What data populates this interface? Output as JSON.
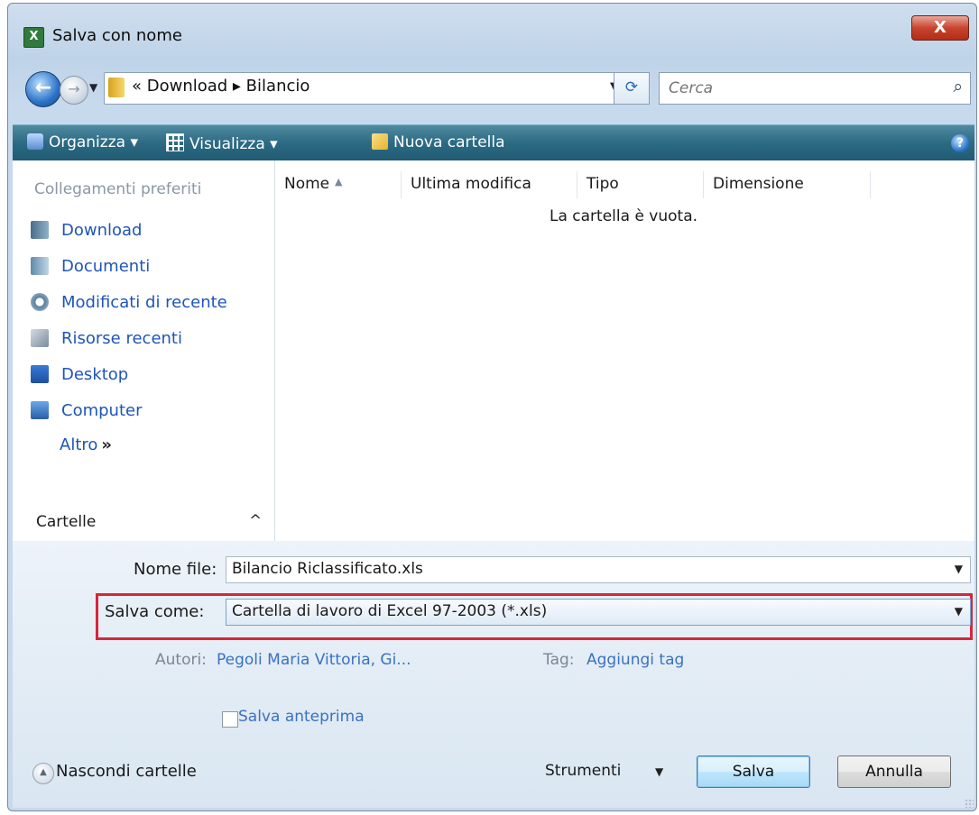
{
  "window": {
    "title": "Salva con nome",
    "close_symbol": "X"
  },
  "nav": {
    "back_symbol": "←",
    "forward_symbol": "→",
    "address": "« Download ▸ Bilancio",
    "search_placeholder": "Cerca"
  },
  "toolbar": {
    "organize": "Organizza ▾",
    "views": "Visualizza ▾",
    "new_folder": "Nuova cartella",
    "help": "?"
  },
  "sidebar": {
    "header": "Collegamenti preferiti",
    "items": [
      {
        "label": "Download",
        "icon": "download-folder-icon"
      },
      {
        "label": "Documenti",
        "icon": "documents-icon"
      },
      {
        "label": "Modificati di recente",
        "icon": "recent-changes-icon"
      },
      {
        "label": "Risorse recenti",
        "icon": "recent-places-icon"
      },
      {
        "label": "Desktop",
        "icon": "desktop-icon"
      },
      {
        "label": "Computer",
        "icon": "computer-icon"
      }
    ],
    "more": "Altro",
    "more_chevrons": "»",
    "folders": "Cartelle",
    "folders_toggle": "^"
  },
  "file_list": {
    "columns": [
      "Nome",
      "Ultima modifica",
      "Tipo",
      "Dimensione"
    ],
    "empty_message": "La cartella è vuota."
  },
  "form": {
    "filename_label": "Nome file:",
    "filename_value": "Bilancio Riclassificato.xls",
    "savetype_label": "Salva come:",
    "savetype_value": "Cartella di lavoro di Excel 97-2003 (*.xls)",
    "authors_label": "Autori:",
    "authors_value": "Pegoli Maria Vittoria, Gi...",
    "tags_label": "Tag:",
    "tags_value": "Aggiungi tag",
    "preview_label": "Salva anteprima"
  },
  "footer": {
    "hide_folders": "Nascondi cartelle",
    "tools": "Strumenti",
    "save": "Salva",
    "cancel": "Annulla"
  },
  "colors": {
    "toolbar": "#2c6a83",
    "highlight_border": "#d8253c",
    "link": "#1f55b8"
  }
}
